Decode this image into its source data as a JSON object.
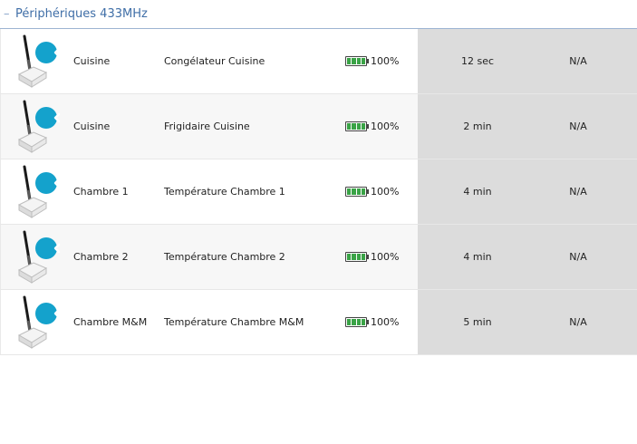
{
  "section": {
    "collapse_glyph": "–",
    "title": "Périphériques 433MHz"
  },
  "columns": [
    "room",
    "name",
    "battery",
    "last_seen",
    "state"
  ],
  "colors": {
    "accent": "#14a2cc",
    "title": "#3f6ea7",
    "battery_fill": "#3aa346",
    "highlight": "#dcdcdc"
  },
  "devices": [
    {
      "icon": "rf-sensor-icon",
      "room": "Cuisine",
      "name": "Congélateur Cuisine",
      "battery": "100%",
      "battery_level": 1.0,
      "last_seen": "12 sec",
      "state": "N/A"
    },
    {
      "icon": "rf-sensor-icon",
      "room": "Cuisine",
      "name": "Frigidaire Cuisine",
      "battery": "100%",
      "battery_level": 1.0,
      "last_seen": "2 min",
      "state": "N/A"
    },
    {
      "icon": "rf-sensor-icon",
      "room": "Chambre 1",
      "name": "Température Chambre 1",
      "battery": "100%",
      "battery_level": 1.0,
      "last_seen": "4 min",
      "state": "N/A"
    },
    {
      "icon": "rf-sensor-icon",
      "room": "Chambre 2",
      "name": "Température Chambre 2",
      "battery": "100%",
      "battery_level": 1.0,
      "last_seen": "4 min",
      "state": "N/A"
    },
    {
      "icon": "rf-sensor-icon",
      "room": "Chambre M&M",
      "name": "Température Chambre M&M",
      "battery": "100%",
      "battery_level": 1.0,
      "last_seen": "5 min",
      "state": "N/A"
    }
  ]
}
